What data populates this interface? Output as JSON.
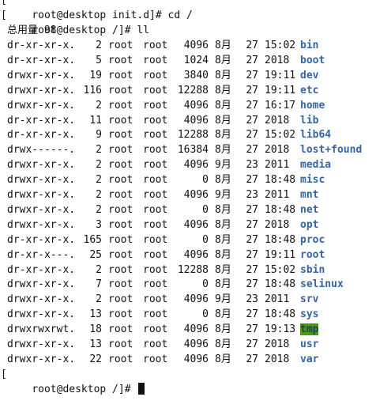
{
  "terminal": {
    "top_line": "root@desktop init.d]# cd /",
    "prompt": "root@desktop /]# ll",
    "total": "总用量 98",
    "final_prompt": "root@desktop /]# ",
    "entries": [
      {
        "perm": "dr-xr-xr-x.",
        "links": "2",
        "owner": "root",
        "group": "root",
        "size": "4096",
        "month": "8月",
        "day": "27",
        "time": "15:02",
        "name": "bin"
      },
      {
        "perm": "dr-xr-xr-x.",
        "links": "5",
        "owner": "root",
        "group": "root",
        "size": "1024",
        "month": "8月",
        "day": "27",
        "time": "2018",
        "name": "boot"
      },
      {
        "perm": "drwxr-xr-x.",
        "links": "19",
        "owner": "root",
        "group": "root",
        "size": "3840",
        "month": "8月",
        "day": "27",
        "time": "19:11",
        "name": "dev"
      },
      {
        "perm": "drwxr-xr-x.",
        "links": "116",
        "owner": "root",
        "group": "root",
        "size": "12288",
        "month": "8月",
        "day": "27",
        "time": "19:11",
        "name": "etc"
      },
      {
        "perm": "drwxr-xr-x.",
        "links": "2",
        "owner": "root",
        "group": "root",
        "size": "4096",
        "month": "8月",
        "day": "27",
        "time": "16:17",
        "name": "home"
      },
      {
        "perm": "dr-xr-xr-x.",
        "links": "11",
        "owner": "root",
        "group": "root",
        "size": "4096",
        "month": "8月",
        "day": "27",
        "time": "2018",
        "name": "lib"
      },
      {
        "perm": "dr-xr-xr-x.",
        "links": "9",
        "owner": "root",
        "group": "root",
        "size": "12288",
        "month": "8月",
        "day": "27",
        "time": "15:02",
        "name": "lib64"
      },
      {
        "perm": "drwx------.",
        "links": "2",
        "owner": "root",
        "group": "root",
        "size": "16384",
        "month": "8月",
        "day": "27",
        "time": "2018",
        "name": "lost+found"
      },
      {
        "perm": "drwxr-xr-x.",
        "links": "2",
        "owner": "root",
        "group": "root",
        "size": "4096",
        "month": "9月",
        "day": "23",
        "time": "2011",
        "name": "media"
      },
      {
        "perm": "drwxr-xr-x.",
        "links": "2",
        "owner": "root",
        "group": "root",
        "size": "0",
        "month": "8月",
        "day": "27",
        "time": "18:48",
        "name": "misc"
      },
      {
        "perm": "drwxr-xr-x.",
        "links": "2",
        "owner": "root",
        "group": "root",
        "size": "4096",
        "month": "9月",
        "day": "23",
        "time": "2011",
        "name": "mnt"
      },
      {
        "perm": "drwxr-xr-x.",
        "links": "2",
        "owner": "root",
        "group": "root",
        "size": "0",
        "month": "8月",
        "day": "27",
        "time": "18:48",
        "name": "net"
      },
      {
        "perm": "drwxr-xr-x.",
        "links": "3",
        "owner": "root",
        "group": "root",
        "size": "4096",
        "month": "8月",
        "day": "27",
        "time": "2018",
        "name": "opt"
      },
      {
        "perm": "dr-xr-xr-x.",
        "links": "165",
        "owner": "root",
        "group": "root",
        "size": "0",
        "month": "8月",
        "day": "27",
        "time": "18:48",
        "name": "proc"
      },
      {
        "perm": "dr-xr-x---.",
        "links": "25",
        "owner": "root",
        "group": "root",
        "size": "4096",
        "month": "8月",
        "day": "27",
        "time": "19:11",
        "name": "root"
      },
      {
        "perm": "dr-xr-xr-x.",
        "links": "2",
        "owner": "root",
        "group": "root",
        "size": "12288",
        "month": "8月",
        "day": "27",
        "time": "15:02",
        "name": "sbin"
      },
      {
        "perm": "drwxr-xr-x.",
        "links": "7",
        "owner": "root",
        "group": "root",
        "size": "0",
        "month": "8月",
        "day": "27",
        "time": "18:48",
        "name": "selinux"
      },
      {
        "perm": "drwxr-xr-x.",
        "links": "2",
        "owner": "root",
        "group": "root",
        "size": "4096",
        "month": "9月",
        "day": "23",
        "time": "2011",
        "name": "srv"
      },
      {
        "perm": "drwxr-xr-x.",
        "links": "13",
        "owner": "root",
        "group": "root",
        "size": "0",
        "month": "8月",
        "day": "27",
        "time": "18:48",
        "name": "sys"
      },
      {
        "perm": "drwxrwxrwt.",
        "links": "18",
        "owner": "root",
        "group": "root",
        "size": "4096",
        "month": "8月",
        "day": "27",
        "time": "19:13",
        "name": "tmp",
        "highlight": true
      },
      {
        "perm": "drwxr-xr-x.",
        "links": "13",
        "owner": "root",
        "group": "root",
        "size": "4096",
        "month": "8月",
        "day": "27",
        "time": "2018",
        "name": "usr"
      },
      {
        "perm": "drwxr-xr-x.",
        "links": "22",
        "owner": "root",
        "group": "root",
        "size": "4096",
        "month": "8月",
        "day": "27",
        "time": "2018",
        "name": "var"
      }
    ]
  },
  "colors": {
    "background": "#ffffff",
    "text": "#111111",
    "directory": "#3465a4",
    "sticky_highlight": "#4e9a06"
  }
}
